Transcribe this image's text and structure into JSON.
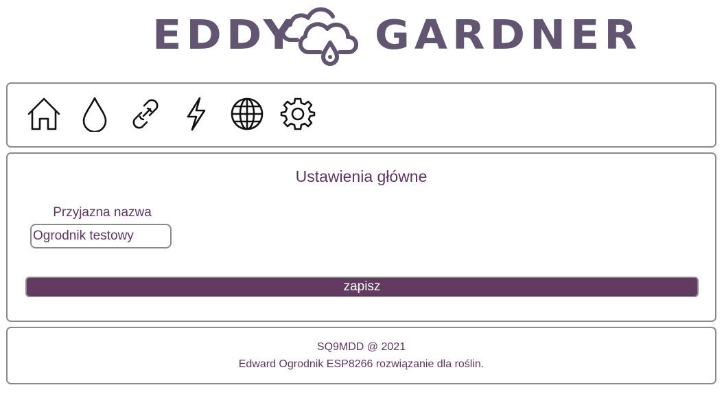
{
  "header": {
    "brand_left": "EDDY",
    "brand_right": "GARDNER",
    "logo_icon": "cloud-droplet-icon",
    "brand_color": "#615572"
  },
  "nav": {
    "items": [
      {
        "icon": "home-icon"
      },
      {
        "icon": "droplet-icon"
      },
      {
        "icon": "link-icon"
      },
      {
        "icon": "lightning-icon"
      },
      {
        "icon": "globe-icon"
      },
      {
        "icon": "gear-icon"
      }
    ]
  },
  "main": {
    "title": "Ustawienia główne",
    "friendly_name_label": "Przyjazna nazwa",
    "friendly_name_value": "Ogrodnik testowy",
    "save_label": "zapisz",
    "accent_color": "#633a62",
    "text_color": "#5e3560"
  },
  "footer": {
    "line1": "SQ9MDD @ 2021",
    "line2": "Edward Ogrodnik ESP8266 rozwiązanie dla roślin."
  }
}
